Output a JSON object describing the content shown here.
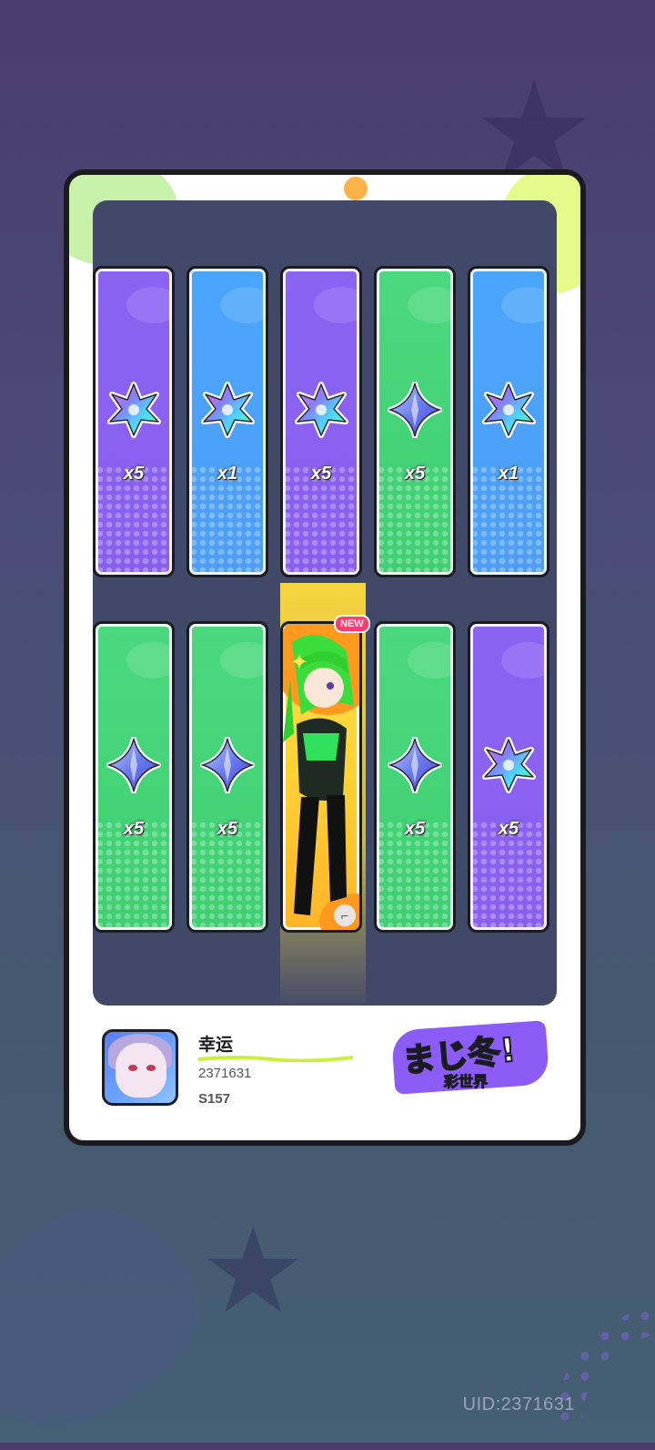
{
  "uid_label": "UID:2371631",
  "colors": {
    "purple": "#8a63f2",
    "blue": "#4aa6fb",
    "green": "#4bd97f",
    "gold": "#ffd133",
    "frame_border": "#1a1a1f",
    "panel": "#414868"
  },
  "rewards": {
    "row1": [
      {
        "color": "purple",
        "icon": "rainbow-star-crystal-icon",
        "qty": "x5"
      },
      {
        "color": "blue",
        "icon": "rainbow-star-crystal-icon",
        "qty": "x1"
      },
      {
        "color": "purple",
        "icon": "rainbow-star-crystal-icon",
        "qty": "x5"
      },
      {
        "color": "green",
        "icon": "blue-star-crystal-icon",
        "qty": "x5"
      },
      {
        "color": "blue",
        "icon": "rainbow-star-crystal-icon",
        "qty": "x1"
      }
    ],
    "row2": [
      {
        "color": "green",
        "icon": "blue-star-crystal-icon",
        "qty": "x5"
      },
      {
        "color": "green",
        "icon": "blue-star-crystal-icon",
        "qty": "x5"
      },
      {
        "color": "gold",
        "icon": "character-portrait",
        "qty": "",
        "new_label": "NEW"
      },
      {
        "color": "green",
        "icon": "blue-star-crystal-icon",
        "qty": "x5"
      },
      {
        "color": "purple",
        "icon": "rainbow-star-crystal-icon",
        "qty": "x5"
      }
    ]
  },
  "player": {
    "name": "幸运",
    "id": "2371631",
    "season": "S157",
    "avatar_icon": "player-avatar"
  },
  "logo": {
    "line1": "まじ冬!",
    "line2": "彩世界"
  }
}
